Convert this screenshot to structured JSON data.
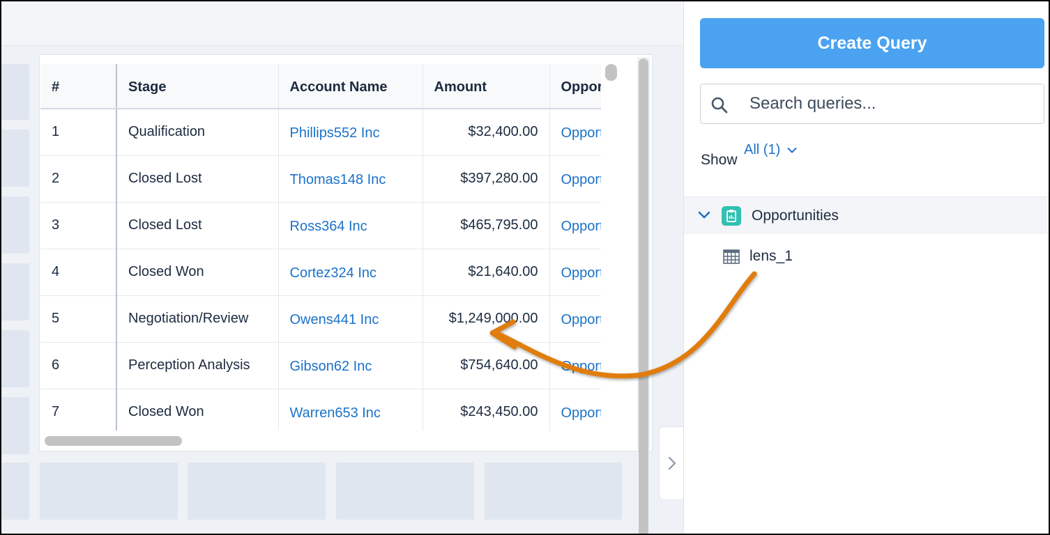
{
  "panel": {
    "create_button_label": "Create Query",
    "search": {
      "placeholder": "Search queries...",
      "value": ""
    },
    "filter": {
      "label": "Show",
      "value": "All (1)"
    },
    "group": {
      "label": "Opportunities",
      "icon": "clipboard-chart-icon",
      "expanded": true
    },
    "items": [
      {
        "label": "lens_1",
        "icon": "table-icon"
      }
    ]
  },
  "table": {
    "columns": [
      "#",
      "Stage",
      "Account Name",
      "Amount",
      "Opportunity"
    ],
    "rows": [
      {
        "num": "1",
        "stage": "Qualification",
        "account": "Phillips552 Inc",
        "amount": "$32,400.00",
        "opportunity": "Opportunity"
      },
      {
        "num": "2",
        "stage": "Closed Lost",
        "account": "Thomas148 Inc",
        "amount": "$397,280.00",
        "opportunity": "Opportunity"
      },
      {
        "num": "3",
        "stage": "Closed Lost",
        "account": "Ross364 Inc",
        "amount": "$465,795.00",
        "opportunity": "Opportunity"
      },
      {
        "num": "4",
        "stage": "Closed Won",
        "account": "Cortez324 Inc",
        "amount": "$21,640.00",
        "opportunity": "Opportunity"
      },
      {
        "num": "5",
        "stage": "Negotiation/Review",
        "account": "Owens441 Inc",
        "amount": "$1,249,000.00",
        "opportunity": "Opportunity"
      },
      {
        "num": "6",
        "stage": "Perception Analysis",
        "account": "Gibson62 Inc",
        "amount": "$754,640.00",
        "opportunity": "Opportunity"
      },
      {
        "num": "7",
        "stage": "Closed Won",
        "account": "Warren653 Inc",
        "amount": "$243,450.00",
        "opportunity": "Opportunity"
      }
    ]
  },
  "colors": {
    "accent": "#4aa2f0",
    "link": "#1b72c9",
    "annotation_arrow": "#e07d10",
    "group_icon": "#2fc1b2"
  }
}
